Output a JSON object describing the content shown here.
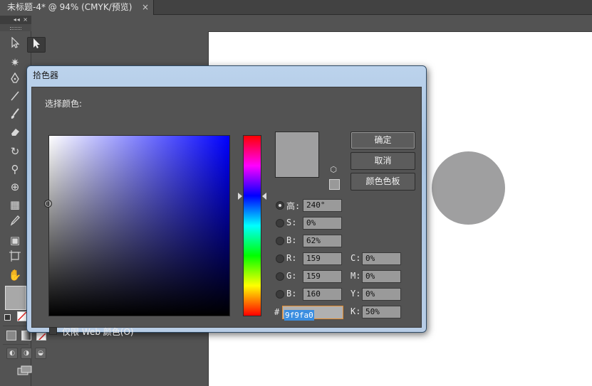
{
  "document_tab": {
    "title": "未标题-4* @ 94% (CMYK/预览)",
    "close_glyph": "×"
  },
  "tool_panel": {
    "collapse_glyph": "◂◂",
    "close_glyph": "×"
  },
  "canvas": {
    "circle_color": "#9f9fa0"
  },
  "dialog": {
    "title": "拾色器",
    "select_label": "选择颜色:",
    "buttons": {
      "ok": "确定",
      "cancel": "取消",
      "swatches": "颜色色板"
    },
    "hsb": [
      {
        "label": "高:",
        "value": "240°",
        "selected": true
      },
      {
        "label": "S:",
        "value": "0%",
        "selected": false
      },
      {
        "label": "B:",
        "value": "62%",
        "selected": false
      }
    ],
    "rgb": [
      {
        "label": "R:",
        "value": "159"
      },
      {
        "label": "G:",
        "value": "159"
      },
      {
        "label": "B:",
        "value": "160"
      }
    ],
    "cmyk": [
      {
        "label": "C:",
        "value": "0%"
      },
      {
        "label": "M:",
        "value": "0%"
      },
      {
        "label": "Y:",
        "value": "0%"
      },
      {
        "label": "K:",
        "value": "50%"
      }
    ],
    "hex_label": "#",
    "hex_value": "9f9fa0",
    "web_only_label": "仅限 Web 颜色(O)",
    "current_color": "#9f9fa0",
    "websafe_color": "#999999"
  }
}
